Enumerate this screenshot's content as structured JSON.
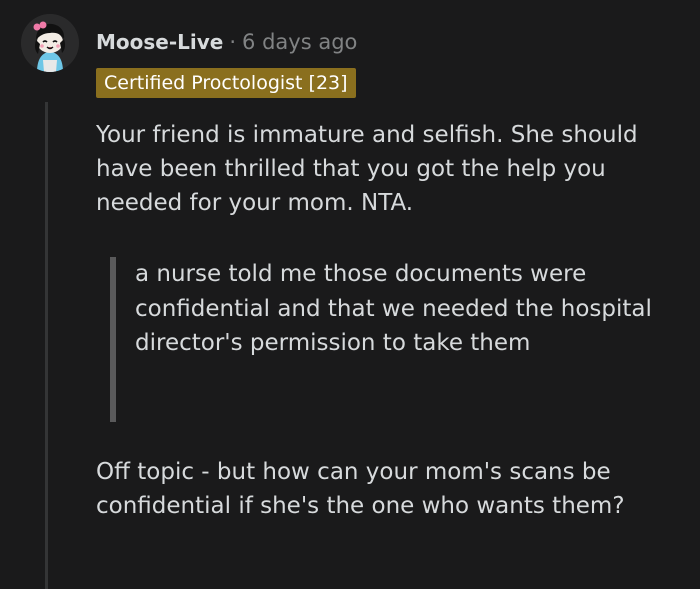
{
  "comment": {
    "username": "Moose-Live",
    "separator": "·",
    "timestamp": "6 days ago",
    "flair": "Certified Proctologist [23]",
    "paragraph_1": "Your friend is immature and selfish. She should have been thrilled that you got the help you needed for your mom. NTA.",
    "quote": "a nurse told me those documents were confidential and that we needed the hospital director's permission to take them",
    "paragraph_2": "Off topic - but how can your mom's scans be confidential if she's the one who wants them?"
  },
  "colors": {
    "background": "#1a1a1b",
    "text": "#d7dadc",
    "muted": "#818384",
    "flair_background": "#8a6f1e",
    "quote_bar": "#5a5a5b"
  },
  "icons": {
    "avatar": "snoo-avatar-icon"
  }
}
